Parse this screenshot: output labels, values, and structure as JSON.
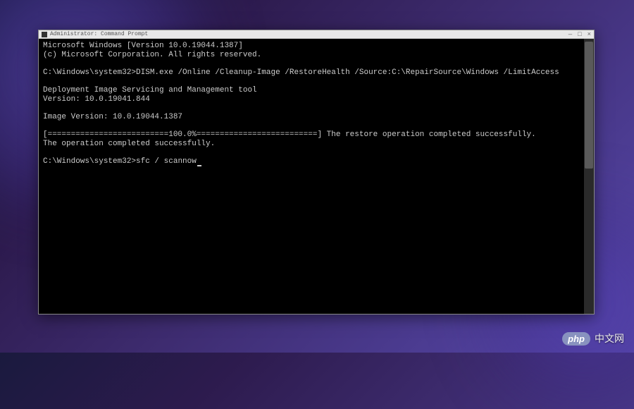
{
  "window": {
    "title": "Administrator: Command Prompt",
    "controls": {
      "minimize": "—",
      "maximize": "□",
      "close": "×"
    }
  },
  "terminal": {
    "header_line1": "Microsoft Windows [Version 10.0.19044.1387]",
    "header_line2": "(c) Microsoft Corporation. All rights reserved.",
    "prompt1_path": "C:\\Windows\\system32>",
    "prompt1_command": "DISM.exe /Online /Cleanup-Image /RestoreHealth /Source:C:\\RepairSource\\Windows /LimitAccess",
    "tool_line1": "Deployment Image Servicing and Management tool",
    "tool_line2": "Version: 10.0.19041.844",
    "image_version": "Image Version: 10.0.19044.1387",
    "progress_line": "[==========================100.0%==========================] The restore operation completed successfully.",
    "completion_line": "The operation completed successfully.",
    "prompt2_path": "C:\\Windows\\system32>",
    "prompt2_command": "sfc / scannow"
  },
  "watermark": {
    "badge": "php",
    "text": "中文网"
  }
}
